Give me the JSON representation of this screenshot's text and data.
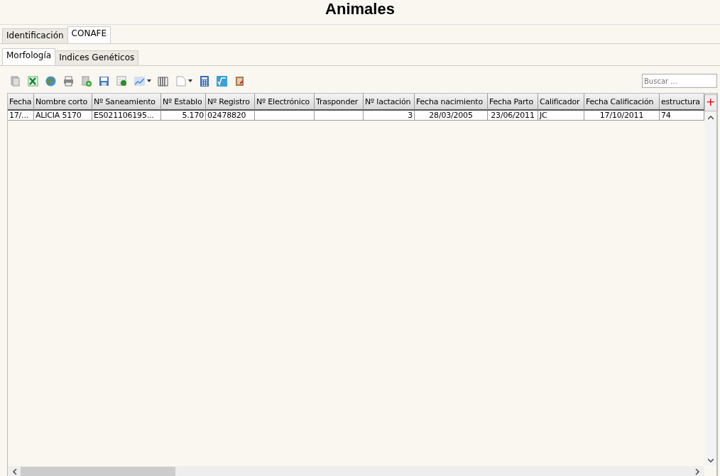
{
  "title": "Animales",
  "tabs": [
    {
      "label": "Identificación",
      "selected": false
    },
    {
      "label": "CONAFE",
      "selected": true
    }
  ],
  "subtabs": [
    {
      "label": "Morfología",
      "selected": true
    },
    {
      "label": "Indices Genéticos",
      "selected": false
    }
  ],
  "toolbar": {
    "search": {
      "placeholder": "Buscar ..."
    }
  },
  "table": {
    "columns": [
      "Fecha",
      "Nombre corto",
      "Nº Saneamiento",
      "Nº Establo",
      "Nº Registro",
      "Nº Electrónico",
      "Trasponder",
      "Nº lactación",
      "Fecha nacimiento",
      "Fecha Parto",
      "Calificador",
      "Fecha Calificación",
      "estructura"
    ],
    "add_column": "+",
    "rows": [
      [
        "17/...",
        "ALICIA 5170",
        "ES021106195...",
        "5.170",
        "02478820",
        "",
        "",
        "3",
        "28/03/2005",
        "23/06/2011",
        "JC",
        "17/10/2011",
        "74"
      ]
    ]
  }
}
